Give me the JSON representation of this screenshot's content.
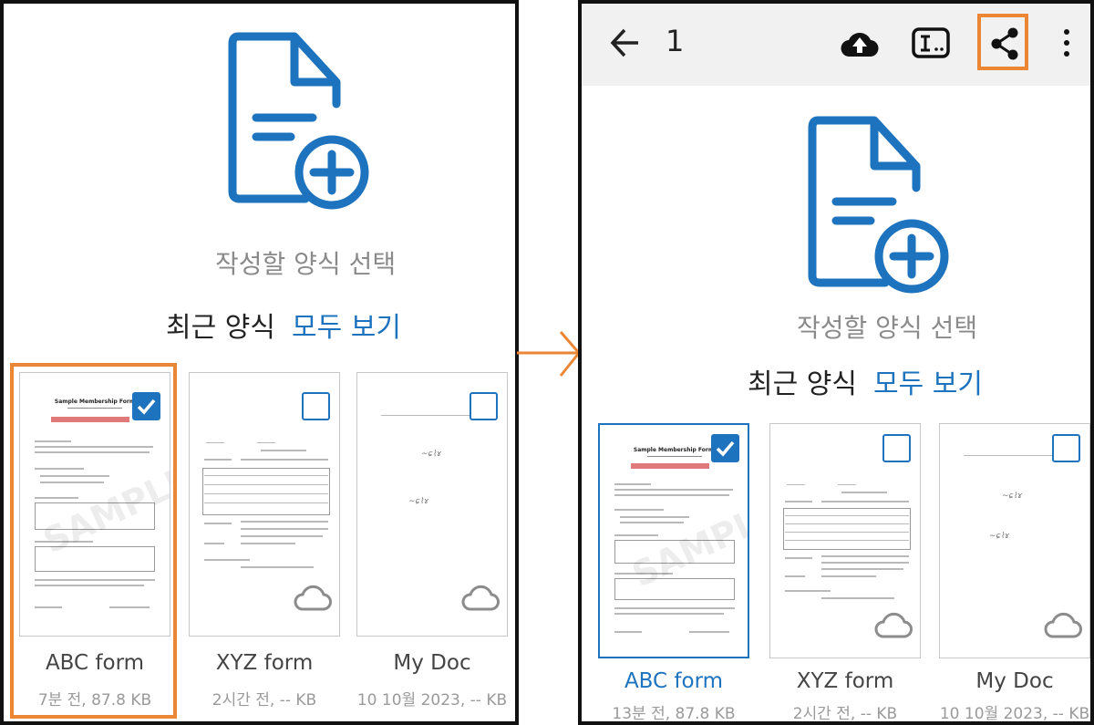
{
  "before": {
    "prompt": "작성할 양식 선택",
    "recent_label": "최근 양식",
    "view_all": "모두 보기",
    "cards": [
      {
        "name": "ABC form",
        "meta": "7분 전, 87.8 KB",
        "selected": true
      },
      {
        "name": "XYZ form",
        "meta": "2시간 전, -- KB",
        "selected": false
      },
      {
        "name": "My Doc",
        "meta": "10 10월 2023, -- KB",
        "selected": false
      }
    ]
  },
  "after": {
    "toolbar": {
      "selected_count": "1",
      "icons": [
        "back-arrow-icon",
        "cloud-upload-icon",
        "rename-icon",
        "share-icon",
        "more-vert-icon"
      ]
    },
    "prompt": "작성할 양식 선택",
    "recent_label": "최근 양식",
    "view_all": "모두 보기",
    "cards": [
      {
        "name": "ABC form",
        "meta": "13분 전, 87.8 KB",
        "selected": true
      },
      {
        "name": "XYZ form",
        "meta": "2시간 전, -- KB",
        "selected": false
      },
      {
        "name": "My Doc",
        "meta": "10 10월 2023, -- KB",
        "selected": false
      }
    ]
  },
  "thumbnails": {
    "abc_title": "Sample Membership Form",
    "abc_watermark": "SAMPLE"
  },
  "colors": {
    "accent": "#1e73be",
    "highlight": "#ea8634",
    "toolbar_bg": "#f1f1f1"
  }
}
